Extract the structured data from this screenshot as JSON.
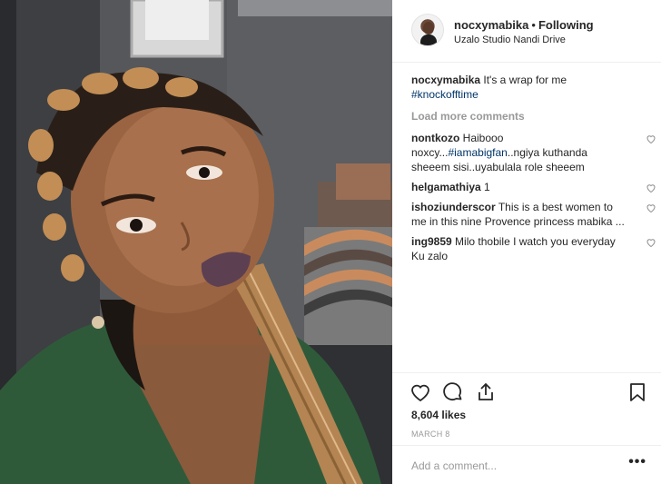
{
  "header": {
    "username": "nocxymabika",
    "separator": "•",
    "follow_status": "Following",
    "location": "Uzalo Studio Nandi Drive"
  },
  "caption": {
    "username": "nocxymabika",
    "text": "It's a wrap for me",
    "hashtag": "#knockofftime"
  },
  "load_more": "Load more comments",
  "comments": [
    {
      "username": "nontkozo",
      "pre": "Haibooo noxcy...",
      "tag": "#iamabigfan",
      "post": "..ngiya kuthanda sheeem sisi..uyabulala role sheeem"
    },
    {
      "username": "helgamathiya",
      "pre": "1",
      "tag": "",
      "post": ""
    },
    {
      "username": "ishoziunderscor",
      "pre": "This is a best women to me in this nine Provence princess mabika ...",
      "tag": "",
      "post": ""
    },
    {
      "username": "ing9859",
      "pre": "Milo thobile I watch you everyday Ku zalo",
      "tag": "",
      "post": ""
    }
  ],
  "actions": {
    "likes": "8,604 likes",
    "date": "MARCH 8",
    "like_icon": "heart-outline-icon",
    "comment_icon": "speech-bubble-icon",
    "share_icon": "share-upload-icon",
    "save_icon": "bookmark-icon"
  },
  "add_comment": {
    "placeholder": "Add a comment...",
    "more": "•••"
  },
  "colors": {
    "text": "#262626",
    "muted": "#999999",
    "hashtag": "#003569",
    "border": "#efefef"
  }
}
